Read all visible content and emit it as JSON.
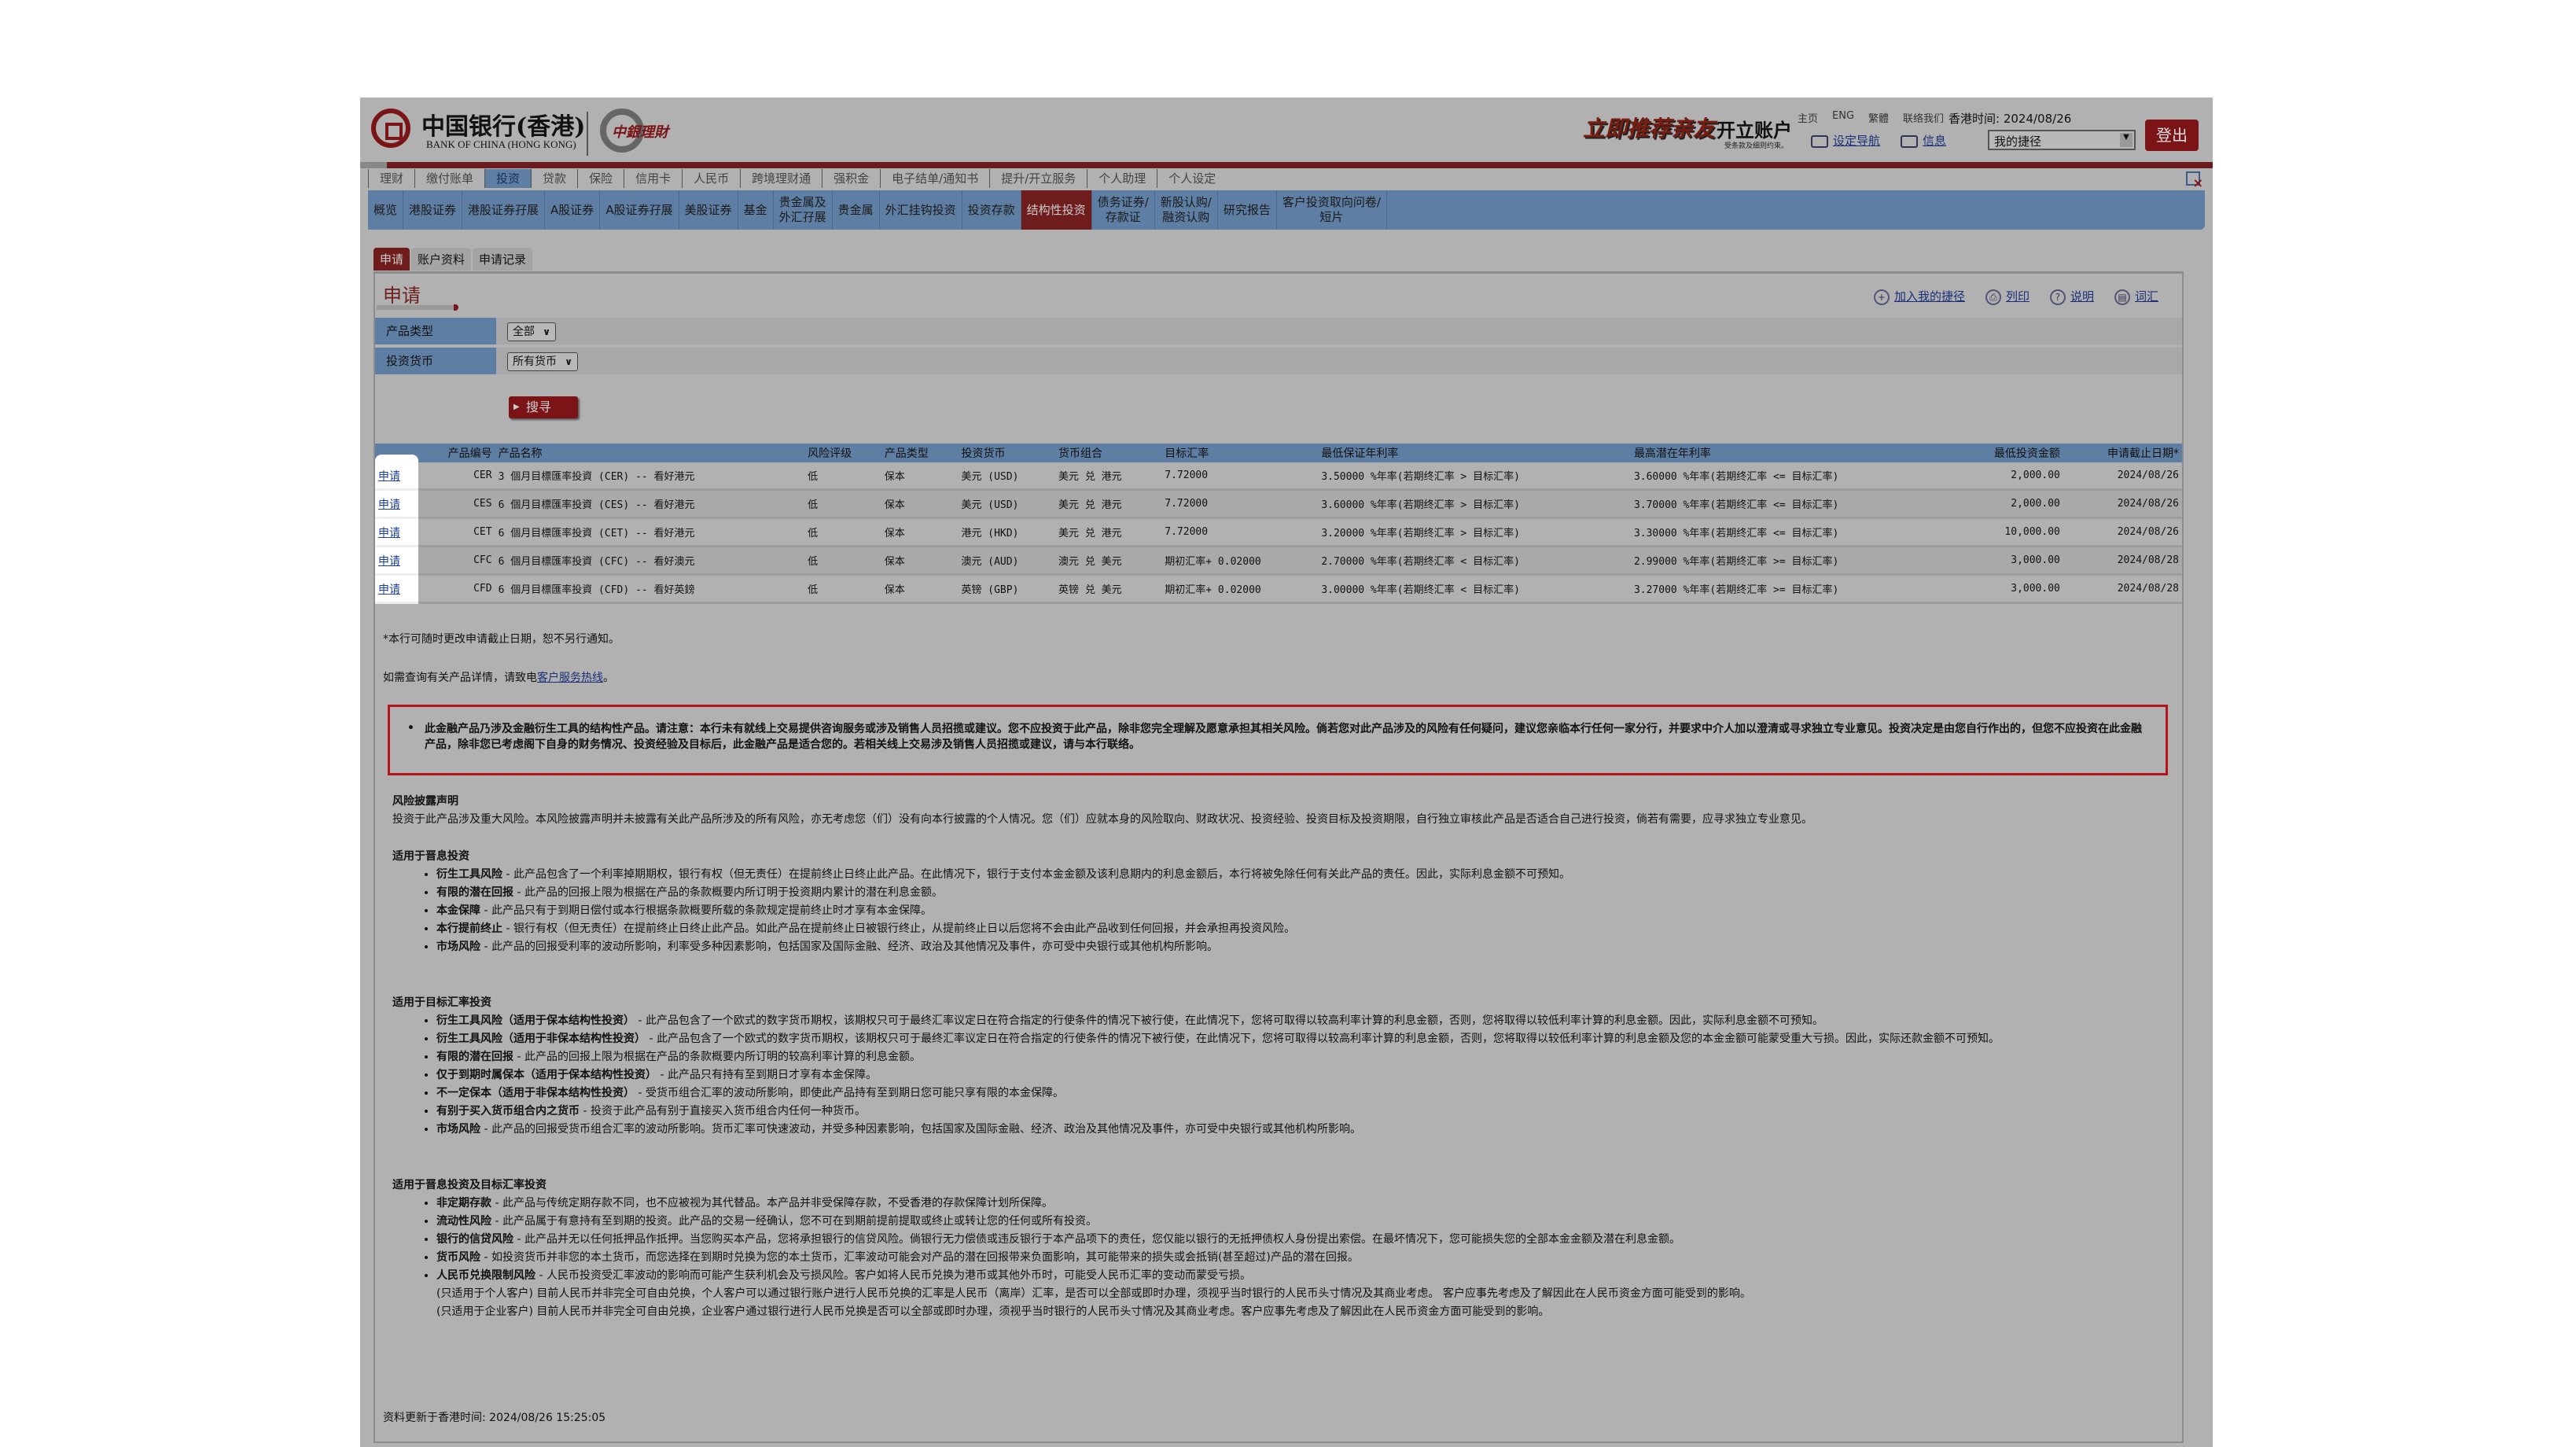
{
  "header": {
    "logo_cn": "中国银行(香港)",
    "logo_en": "BANK OF CHINA (HONG KONG)",
    "wealth_logo": "中銀理財",
    "promo_main": "立即推荐亲友",
    "promo_action": "开立账户",
    "promo_sub": "受条款及细则约束。",
    "top_links": [
      "主页",
      "ENG",
      "繁體",
      "联络我们"
    ],
    "hk_time": "香港时间: 2024/08/26",
    "nav_setting": "设定导航",
    "messages": "信息",
    "shortcut_select": "我的捷径",
    "logout": "登出"
  },
  "main_nav": [
    "理财",
    "缴付账单",
    "投资",
    "贷款",
    "保险",
    "信用卡",
    "人民币",
    "跨境理财通",
    "强积金",
    "电子结单/通知书",
    "提升/开立服务",
    "个人助理",
    "个人设定"
  ],
  "main_nav_active": "投资",
  "sub_nav": [
    "概览",
    "港股证券",
    "港股证券孖展",
    "A股证券",
    "A股证券孖展",
    "美股证券",
    "基金",
    "贵金属及\n外汇孖展",
    "贵金属",
    "外汇挂钩投资",
    "投资存款",
    "结构性投资",
    "债务证券/\n存款证",
    "新股认购/\n融资认购",
    "研究报告",
    "客户投资取向问卷/\n短片"
  ],
  "sub_nav_active": "结构性投资",
  "tabs": [
    "申请",
    "账户资料",
    "申请记录"
  ],
  "page_title": "申请",
  "tools": [
    "加入我的捷径",
    "列印",
    "说明",
    "词汇"
  ],
  "filters": {
    "product_type_label": "产品类型",
    "product_type_value": "全部",
    "currency_label": "投资货币",
    "currency_value": "所有货币",
    "search_button": "搜寻"
  },
  "table": {
    "headers": [
      "",
      "产品编号",
      "产品名称",
      "风险评级",
      "产品类型",
      "投资货币",
      "货币组合",
      "目标汇率",
      "最低保证年利率",
      "最高潜在年利率",
      "最低投资金额",
      "申请截止日期*"
    ],
    "rows": [
      [
        "申请",
        "CER",
        "3 個月目標匯率投資 (CER) -- 看好港元",
        "低",
        "保本",
        "美元 (USD)",
        "美元 兑 港元",
        "7.72000",
        "3.50000 %年率(若期终汇率 > 目标汇率)",
        "3.60000 %年率(若期终汇率 <= 目标汇率)",
        "2,000.00",
        "2024/08/26"
      ],
      [
        "申请",
        "CES",
        "6 個月目標匯率投資 (CES) -- 看好港元",
        "低",
        "保本",
        "美元 (USD)",
        "美元 兑 港元",
        "7.72000",
        "3.60000 %年率(若期终汇率 > 目标汇率)",
        "3.70000 %年率(若期终汇率 <= 目标汇率)",
        "2,000.00",
        "2024/08/26"
      ],
      [
        "申请",
        "CET",
        "6 個月目標匯率投資 (CET) -- 看好港元",
        "低",
        "保本",
        "港元 (HKD)",
        "美元 兑 港元",
        "7.72000",
        "3.20000 %年率(若期终汇率 > 目标汇率)",
        "3.30000 %年率(若期终汇率 <= 目标汇率)",
        "10,000.00",
        "2024/08/26"
      ],
      [
        "申请",
        "CFC",
        "6 個月目標匯率投資 (CFC) -- 看好澳元",
        "低",
        "保本",
        "澳元 (AUD)",
        "澳元 兑 美元",
        "期初汇率+ 0.02000",
        "2.70000 %年率(若期终汇率 < 目标汇率)",
        "2.99000 %年率(若期终汇率 >= 目标汇率)",
        "3,000.00",
        "2024/08/28"
      ],
      [
        "申请",
        "CFD",
        "6 個月目標匯率投資 (CFD) -- 看好英鎊",
        "低",
        "保本",
        "英镑 (GBP)",
        "英镑 兑 美元",
        "期初汇率+ 0.02000",
        "3.00000 %年率(若期终汇率 < 目标汇率)",
        "3.27000 %年率(若期终汇率 >= 目标汇率)",
        "3,000.00",
        "2024/08/28"
      ]
    ]
  },
  "notes": {
    "deadline_note": "*本行可随时更改申请截止日期，恕不另行通知。",
    "enquiry_prefix": "如需查询有关产品详情，请致电",
    "enquiry_link": "客户服务热线",
    "enquiry_suffix": "。"
  },
  "warning": "此金融产品乃涉及金融衍生工具的结构性产品。请注意：本行未有就线上交易提供咨询服务或涉及销售人员招揽或建议。您不应投资于此产品，除非您完全理解及愿意承担其相关风险。倘若您对此产品涉及的风险有任何疑问，建议您亲临本行任何一家分行，并要求中介人加以澄清或寻求独立专业意见。投资决定是由您自行作出的，但您不应投资在此金融产品，除非您已考虑阁下自身的财务情况、投资经验及目标后，此金融产品是适合您的。若相关线上交易涉及销售人员招揽或建议，请与本行联络。",
  "risk": {
    "title": "风险披露声明",
    "intro": "投资于此产品涉及重大风险。本风险披露声明并未披露有关此产品所涉及的所有风险，亦无考虑您（们）没有向本行披露的个人情况。您（们）应就本身的风险取向、财政状况、投资经验、投资目标及投资期限，自行独立审核此产品是否适合自己进行投资，倘若有需要，应寻求独立专业意见。",
    "sections": [
      {
        "heading": "适用于晋息投资",
        "items": [
          {
            "term": "衍生工具风险",
            "text": " - 此产品包含了一个利率掉期期权，银行有权（但无责任）在提前终止日终止此产品。在此情况下，银行于支付本金金额及该利息期内的利息金额后，本行将被免除任何有关此产品的责任。因此，实际利息金额不可预知。"
          },
          {
            "term": "有限的潜在回报",
            "text": " - 此产品的回报上限为根据在产品的条款概要内所订明于投资期内累计的潜在利息金额。"
          },
          {
            "term": "本金保障",
            "text": " - 此产品只有于到期日偿付或本行根据条款概要所载的条款规定提前终止时才享有本金保障。"
          },
          {
            "term": "本行提前终止",
            "text": " - 银行有权（但无责任）在提前终止日终止此产品。如此产品在提前终止日被银行终止，从提前终止日以后您将不会由此产品收到任何回报，并会承担再投资风险。"
          },
          {
            "term": "市场风险",
            "text": " - 此产品的回报受利率的波动所影响，利率受多种因素影响，包括国家及国际金融、经济、政治及其他情况及事件，亦可受中央银行或其他机构所影响。"
          }
        ]
      },
      {
        "heading": "适用于目标汇率投资",
        "items": [
          {
            "term": "衍生工具风险（适用于保本结构性投资）",
            "text": " - 此产品包含了一个欧式的数字货币期权，该期权只可于最终汇率议定日在符合指定的行使条件的情况下被行使，在此情况下，您将可取得以较高利率计算的利息金额，否则，您将取得以较低利率计算的利息金额。因此，实际利息金额不可预知。"
          },
          {
            "term": "衍生工具风险（适用于非保本结构性投资）",
            "text": " - 此产品包含了一个欧式的数字货币期权，该期权只可于最终汇率议定日在符合指定的行使条件的情况下被行使，在此情况下，您将可取得以较高利率计算的利息金额，否则，您将取得以较低利率计算的利息金额及您的本金金额可能蒙受重大亏损。因此，实际还款金额不可预知。"
          },
          {
            "term": "有限的潜在回报",
            "text": " - 此产品的回报上限为根据在产品的条款概要内所订明的较高利率计算的利息金额。"
          },
          {
            "term": "仅于到期时属保本（适用于保本结构性投资）",
            "text": " - 此产品只有持有至到期日才享有本金保障。"
          },
          {
            "term": "不一定保本（适用于非保本结构性投资）",
            "text": " - 受货币组合汇率的波动所影响，即使此产品持有至到期日您可能只享有限的本金保障。"
          },
          {
            "term": "有别于买入货币组合内之货币",
            "text": " - 投资于此产品有别于直接买入货币组合内任何一种货币。"
          },
          {
            "term": "市场风险",
            "text": " - 此产品的回报受货币组合汇率的波动所影响。货币汇率可快速波动，并受多种因素影响，包括国家及国际金融、经济、政治及其他情况及事件，亦可受中央银行或其他机构所影响。"
          }
        ]
      },
      {
        "heading": "适用于晋息投资及目标汇率投资",
        "items": [
          {
            "term": "非定期存款",
            "text": " - 此产品与传统定期存款不同，也不应被视为其代替品。本产品并非受保障存款，不受香港的存款保障计划所保障。"
          },
          {
            "term": "流动性风险",
            "text": " - 此产品属于有意持有至到期的投资。此产品的交易一经确认，您不可在到期前提前提取或终止或转让您的任何或所有投资。"
          },
          {
            "term": "银行的信贷风险",
            "text": " - 此产品并无以任何抵押品作抵押。当您购买本产品，您将承担银行的信贷风险。倘银行无力偿债或违反银行于本产品项下的责任，您仅能以银行的无抵押债权人身份提出索偿。在最坏情况下，您可能损失您的全部本金金额及潜在利息金额。"
          },
          {
            "term": "货币风险",
            "text": " - 如投资货币并非您的本土货币，而您选择在到期时兑换为您的本土货币，汇率波动可能会对产品的潜在回报带来负面影响，其可能带来的损失或会抵销(甚至超过)产品的潜在回报。"
          },
          {
            "term": "人民币兑换限制风险",
            "text": " - 人民币投资受汇率波动的影响而可能产生获利机会及亏损风险。客户如将人民币兑换为港币或其他外币时，可能受人民币汇率的变动而蒙受亏损。",
            "subs": [
              "(只适用于个人客户) 目前人民币并非完全可自由兑换，个人客户可以通过银行账户进行人民币兑换的汇率是人民币（离岸）汇率，是否可以全部或即时办理，须视乎当时银行的人民币头寸情况及其商业考虑。 客户应事先考虑及了解因此在人民币资金方面可能受到的影响。",
              "(只适用于企业客户) 目前人民币并非完全可自由兑换，企业客户通过银行进行人民币兑换是否可以全部或即时办理，须视乎当时银行的人民币头寸情况及其商业考虑。客户应事先考虑及了解因此在人民币资金方面可能受到的影响。"
            ]
          }
        ]
      }
    ]
  },
  "footer": "资料更新于香港时间: 2024/08/26 15:25:05",
  "colors": {
    "brand_red": "#7a1416",
    "nav_blue": "#5e7fa3",
    "warning_border": "#b3131a",
    "link": "#1b2f78"
  }
}
